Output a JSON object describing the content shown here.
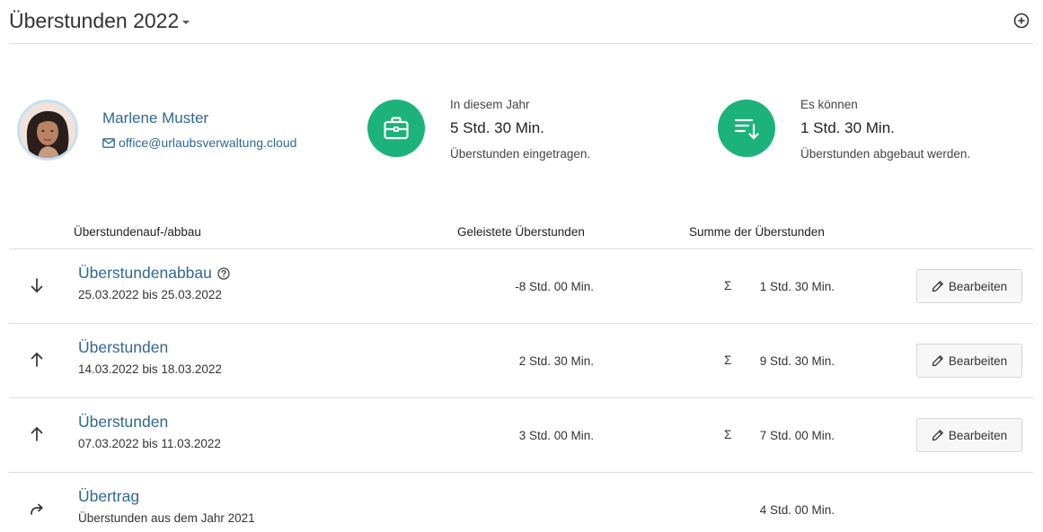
{
  "header": {
    "title": "Überstunden 2022",
    "add_icon": "plus-circle-icon"
  },
  "person": {
    "name": "Marlene Muster",
    "email": "office@urlaubsverwaltung.cloud"
  },
  "stats": [
    {
      "icon": "briefcase-icon",
      "label": "In diesem Jahr",
      "value": "5 Std. 30 Min.",
      "sub": "Überstunden eingetragen."
    },
    {
      "icon": "sort-down-icon",
      "label": "Es können",
      "value": "1 Std. 30 Min.",
      "sub": "Überstunden abgebaut werden."
    }
  ],
  "table": {
    "headers": {
      "type": "Überstundenauf-/abbau",
      "hours": "Geleistete Überstunden",
      "sum": "Summe der Überstunden"
    },
    "rows": [
      {
        "icon": "arrow-down-icon",
        "title": "Überstundenabbau",
        "has_help": true,
        "sub": "25.03.2022 bis 25.03.2022",
        "hours": "-8 Std. 00 Min.",
        "sigma": "Σ",
        "sum": "1 Std. 30 Min.",
        "edit": "Bearbeiten"
      },
      {
        "icon": "arrow-up-icon",
        "title": "Überstunden",
        "has_help": false,
        "sub": "14.03.2022 bis 18.03.2022",
        "hours": "2 Std. 30 Min.",
        "sigma": "Σ",
        "sum": "9 Std. 30 Min.",
        "edit": "Bearbeiten"
      },
      {
        "icon": "arrow-up-icon",
        "title": "Überstunden",
        "has_help": false,
        "sub": "07.03.2022 bis 11.03.2022",
        "hours": "3 Std. 00 Min.",
        "sigma": "Σ",
        "sum": "7 Std. 00 Min.",
        "edit": "Bearbeiten"
      },
      {
        "icon": "redo-arrow-icon",
        "title": "Übertrag",
        "has_help": false,
        "sub": "Überstunden aus dem Jahr 2021",
        "hours": "",
        "sigma": "",
        "sum": "4 Std. 00 Min.",
        "edit": ""
      }
    ]
  }
}
